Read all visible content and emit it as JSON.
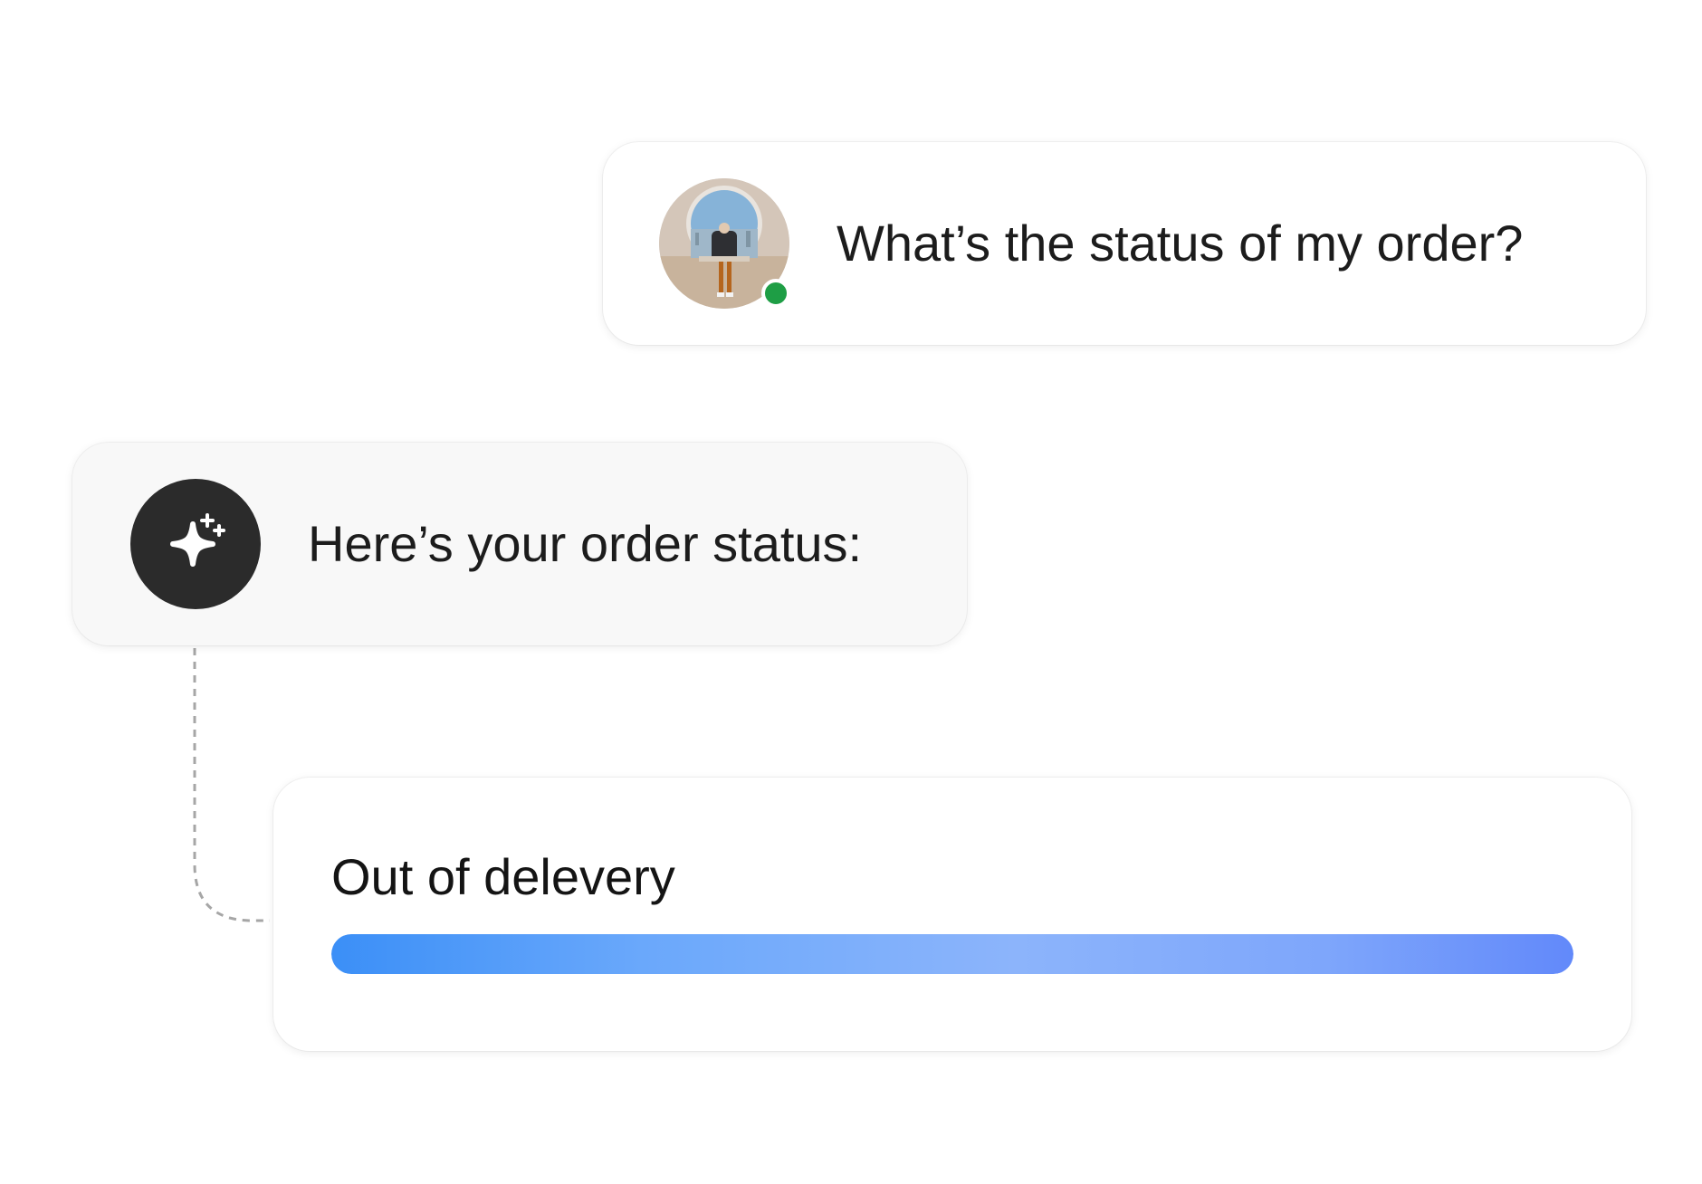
{
  "conversation": {
    "user_message": {
      "text": "What’s the status of my order?",
      "avatar_icon": "user-photo-avatar",
      "online_status_color": "#1e9e45"
    },
    "bot_message": {
      "text": "Here’s your order status:",
      "icon": "sparkles-icon",
      "icon_bg": "#2b2b2b"
    },
    "order_status": {
      "label": "Out of delevery",
      "progress": 1.0,
      "progress_colors": [
        "#3b8ff7",
        "#8cb4fb",
        "#6289fa"
      ]
    }
  }
}
